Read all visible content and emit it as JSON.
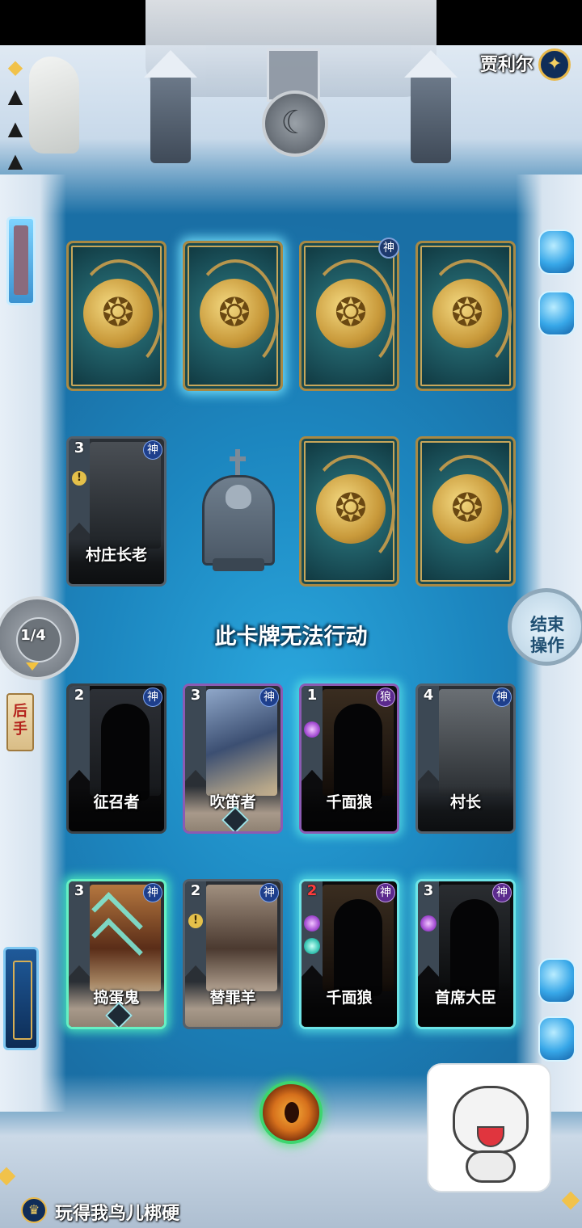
{
  "opponent": {
    "name": "贾利尔",
    "avatar_icon": "shield-emblem-icon"
  },
  "player": {
    "name": "玩得我鸟儿梆硬",
    "avatar_icon": "crown-icon"
  },
  "turn": {
    "counter": "1/4",
    "order_label": "后手"
  },
  "end_button_label": "结束操作",
  "hint_text": "此卡牌无法行动",
  "opponent_hidden_cards": [
    {
      "badge": ""
    },
    {
      "badge": ""
    },
    {
      "badge": "神"
    },
    {
      "badge": ""
    }
  ],
  "elder_card": {
    "name": "村庄长老",
    "cost": "3",
    "faction": "神"
  },
  "row_one": [
    {
      "name": "征召者",
      "cost": "2",
      "faction": "神"
    },
    {
      "name": "吹笛者",
      "cost": "3",
      "faction": "神"
    },
    {
      "name": "千面狼",
      "cost": "1",
      "faction": "狼"
    },
    {
      "name": "村长",
      "cost": "4",
      "faction": "神"
    }
  ],
  "row_two": [
    {
      "name": "捣蛋鬼",
      "cost": "3",
      "faction": "神"
    },
    {
      "name": "替罪羊",
      "cost": "2",
      "faction": "神"
    },
    {
      "name": "千面狼",
      "cost": "2",
      "faction": "神"
    },
    {
      "name": "首席大臣",
      "cost": "3",
      "faction": "神"
    }
  ],
  "colors": {
    "board_blue": "#1c86bf",
    "gold": "#c99a3b",
    "highlight_green": "#66f0c3",
    "end_button_text": "#1f4f72"
  }
}
